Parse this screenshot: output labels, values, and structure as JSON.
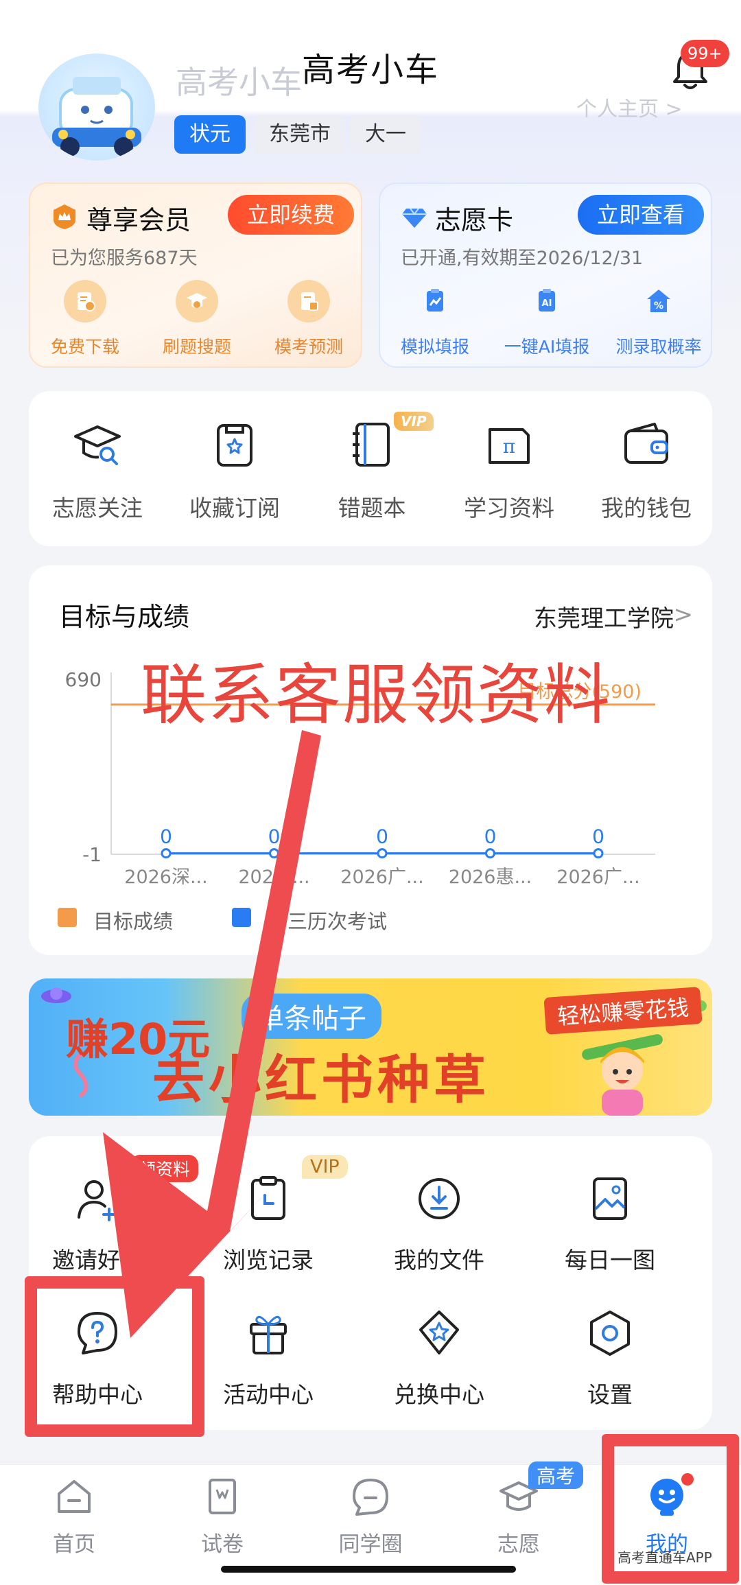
{
  "header": {
    "title": "高考小车",
    "notification_count": "99+"
  },
  "profile": {
    "name": "高考小车",
    "home_link": "个人主页 >",
    "tags": [
      "状元",
      "东莞市",
      "大一"
    ]
  },
  "vip_card": {
    "title": "尊享会员",
    "button": "立即续费",
    "subtitle": "已为您服务687天",
    "features": [
      "免费下载",
      "刷题搜题",
      "模考预测"
    ]
  },
  "wish_card": {
    "title": "志愿卡",
    "button": "立即查看",
    "subtitle": "已开通,有效期至2026/12/31",
    "features": [
      "模拟填报",
      "一键AI填报",
      "测录取概率"
    ]
  },
  "shortcuts": {
    "vip_flag": "VIP",
    "items": [
      {
        "label": "志愿关注",
        "icon": "grad-cap-search-icon"
      },
      {
        "label": "收藏订阅",
        "icon": "bookmark-star-icon"
      },
      {
        "label": "错题本",
        "icon": "notebook-icon"
      },
      {
        "label": "学习资料",
        "icon": "pi-folder-icon"
      },
      {
        "label": "我的钱包",
        "icon": "wallet-icon"
      }
    ]
  },
  "goals": {
    "title": "目标与成绩",
    "school": "东莞理工学院",
    "chevron": ">"
  },
  "chart_data": {
    "type": "line",
    "categories": [
      "2026深...",
      "202汕...",
      "2026广...",
      "2026惠...",
      "2026广..."
    ],
    "series": [
      {
        "name": "目标成绩",
        "values": [
          590,
          590,
          590,
          590,
          590
        ],
        "color": "#f39b4b"
      },
      {
        "name": "高三历次考试",
        "values": [
          0,
          0,
          0,
          0,
          0
        ],
        "color": "#2a7cf2"
      }
    ],
    "y_ticks": [
      "690",
      "-1"
    ],
    "ylim": [
      -1,
      690
    ],
    "target_label": "目标总分(590)",
    "data_labels": [
      "0",
      "0",
      "0",
      "0",
      "0"
    ],
    "legend": [
      "目标成绩",
      "高三历次考试"
    ],
    "legend_position": "bottom-left"
  },
  "overlay": {
    "text": "联系客服领资料",
    "color": "#e8463c"
  },
  "banner": {
    "earn": "赚20元",
    "chip": "单条帖子",
    "main": "去小红书种草",
    "tag": "轻松赚零花钱"
  },
  "tools": {
    "badge_red": "领资料",
    "badge_vip": "VIP",
    "items": [
      {
        "label": "邀请好友",
        "icon": "add-user-icon"
      },
      {
        "label": "浏览记录",
        "icon": "clipboard-clock-icon"
      },
      {
        "label": "我的文件",
        "icon": "download-circle-icon"
      },
      {
        "label": "每日一图",
        "icon": "picture-icon"
      },
      {
        "label": "帮助中心",
        "icon": "help-bubble-icon"
      },
      {
        "label": "活动中心",
        "icon": "gift-icon"
      },
      {
        "label": "兑换中心",
        "icon": "star-diamond-icon"
      },
      {
        "label": "设置",
        "icon": "settings-hex-icon"
      }
    ]
  },
  "tabbar": {
    "badge": "高考",
    "items": [
      {
        "label": "首页",
        "icon": "home-icon"
      },
      {
        "label": "试卷",
        "icon": "paper-icon"
      },
      {
        "label": "同学圈",
        "icon": "chat-icon"
      },
      {
        "label": "志愿",
        "icon": "grad-cap-icon"
      },
      {
        "label": "我的",
        "icon": "mascot-icon"
      }
    ],
    "active_index": 4
  },
  "watermark": "高考直通车APP",
  "colors": {
    "accent": "#1f7af5",
    "danger": "#f0413d",
    "highlight": "#ef4c4f"
  }
}
